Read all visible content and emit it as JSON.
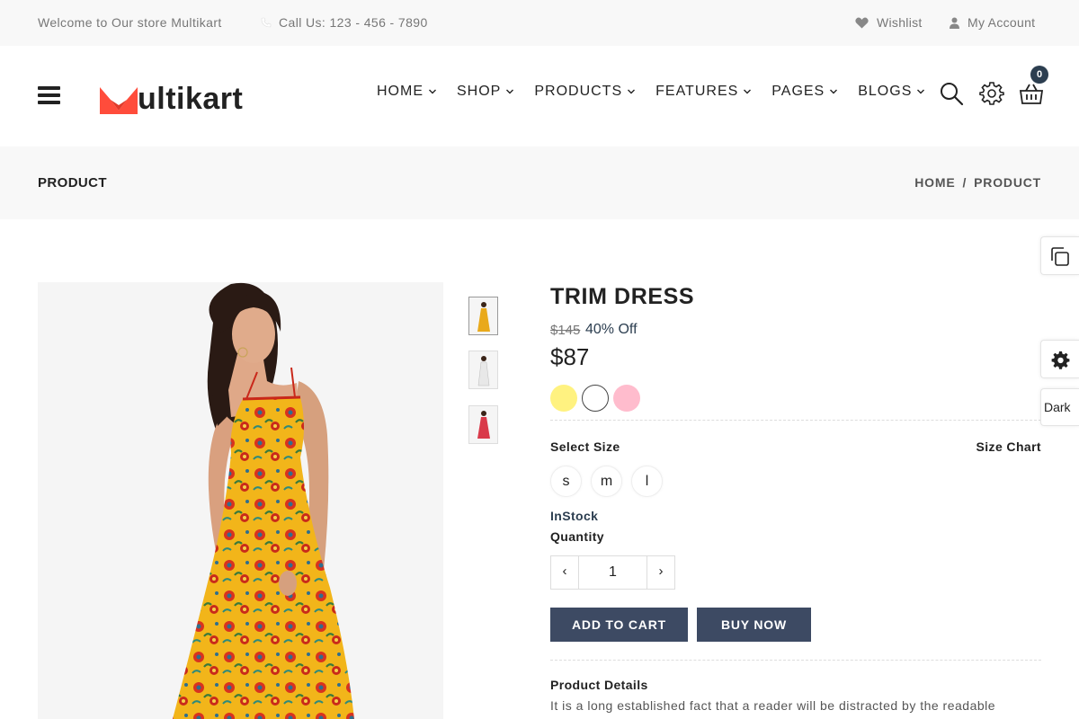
{
  "topbar": {
    "welcome": "Welcome to Our store Multikart",
    "phone": "Call Us: 123 - 456 - 7890",
    "wishlist": "Wishlist",
    "account": "My Account"
  },
  "header": {
    "logo_text": "ultikart",
    "nav": [
      "HOME",
      "SHOP",
      "PRODUCTS",
      "FEATURES",
      "PAGES",
      "BLOGS"
    ],
    "cart_count": "0",
    "icons": [
      "hamburger-menu-icon",
      "search-icon",
      "gear-icon",
      "shopping-basket-icon"
    ]
  },
  "breadcrumb": {
    "title": "PRODUCT",
    "trail_home": "HOME",
    "separator": "/",
    "trail_current": "PRODUCT"
  },
  "product": {
    "title": "TRIM DRESS",
    "old_price": "$145",
    "discount": "40% Off",
    "price": "$87",
    "colors": [
      "#fff280",
      "#ffffff",
      "#ffbccd"
    ],
    "select_size_label": "Select Size",
    "size_chart_label": "Size Chart",
    "sizes": [
      "s",
      "m",
      "l"
    ],
    "stock": "InStock",
    "quantity_label": "Quantity",
    "quantity": "1",
    "qty_minus": "‹",
    "qty_plus": "›",
    "add_to_cart": "ADD TO CART",
    "buy_now": "BUY NOW",
    "details_title": "Product Details",
    "details_text": "It is a long established fact that a reader will be distracted by the readable"
  },
  "side": {
    "dark_label": "Dark"
  },
  "colors": {
    "accent": "#3d4a63",
    "brand": "#ff4c3b",
    "topbar_bg": "#f8f8f8"
  }
}
